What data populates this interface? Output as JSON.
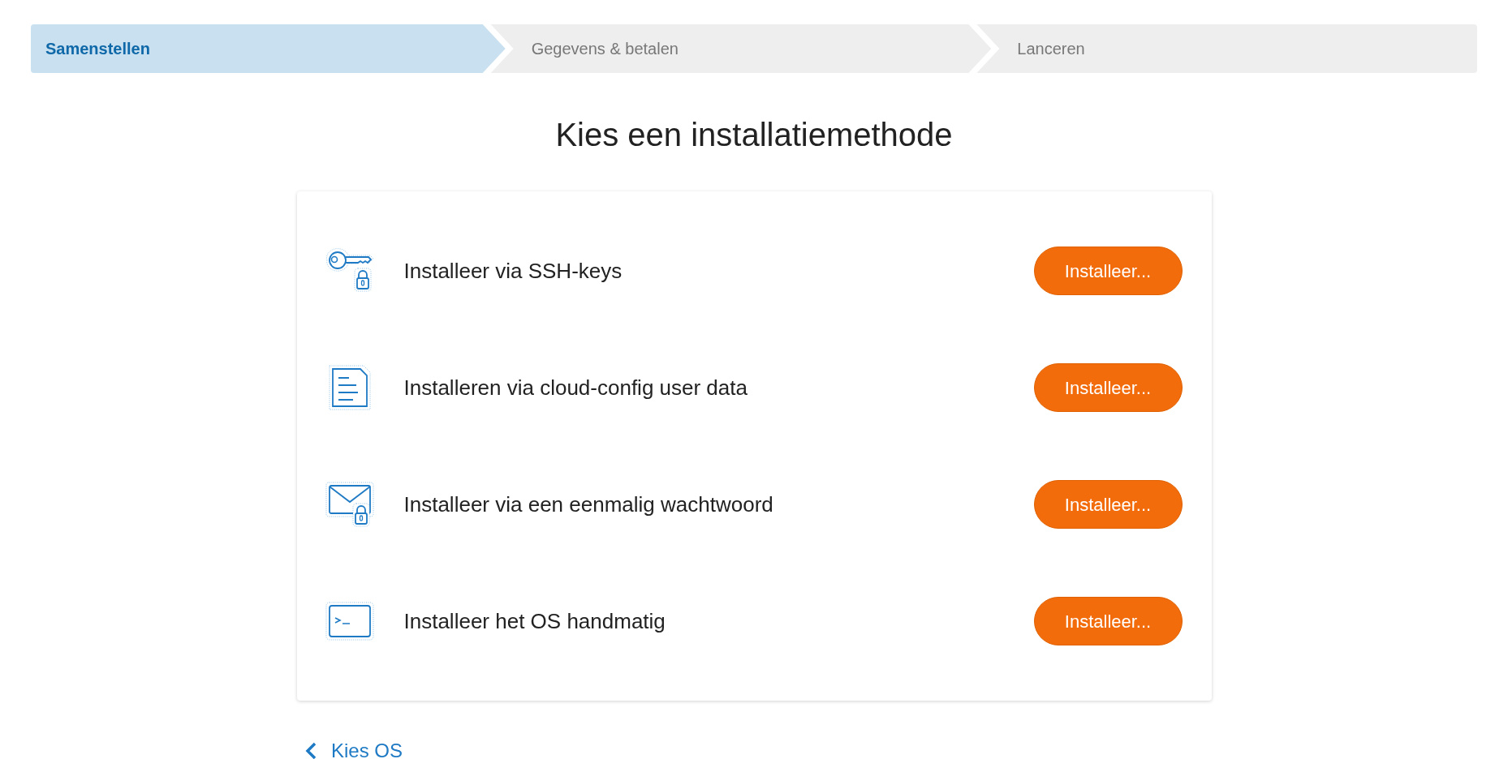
{
  "steps": [
    {
      "label": "Samenstellen",
      "selected": true
    },
    {
      "label": "Gegevens & betalen",
      "selected": false
    },
    {
      "label": "Lanceren",
      "selected": false
    }
  ],
  "title": "Kies een installatiemethode",
  "methods": [
    {
      "kind": "key-lock",
      "label": "Installeer via SSH-keys",
      "button": "Installeer..."
    },
    {
      "kind": "document",
      "label": "Installeren via cloud-config user data",
      "button": "Installeer..."
    },
    {
      "kind": "mail-lock",
      "label": "Installeer via een eenmalig wachtwoord",
      "button": "Installeer..."
    },
    {
      "kind": "terminal",
      "label": "Installeer het OS handmatig",
      "button": "Installeer..."
    }
  ],
  "back_link": "Kies OS"
}
